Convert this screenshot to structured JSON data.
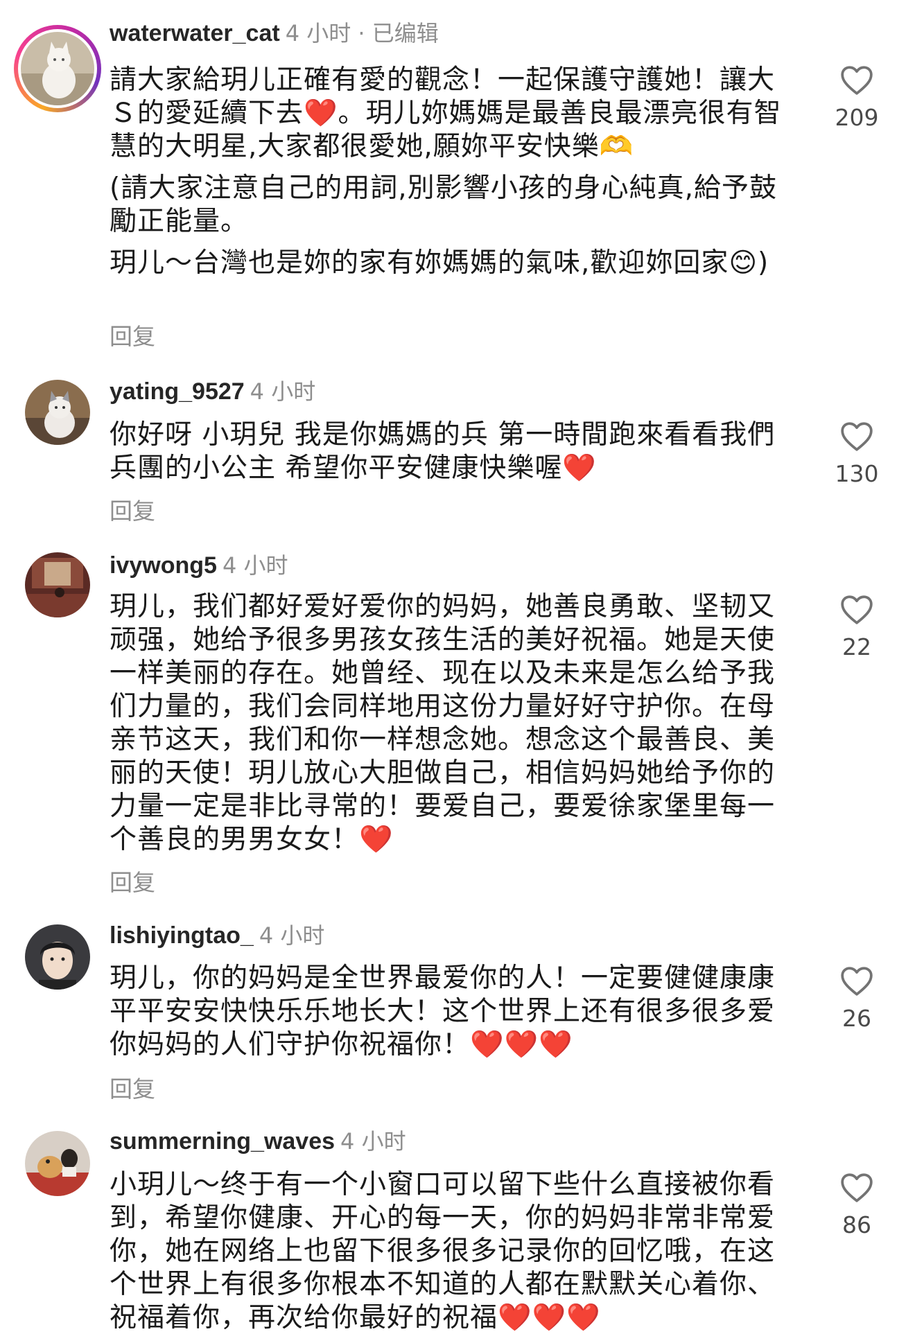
{
  "comments": [
    {
      "username": "waterwater_cat",
      "meta": "4 小时 · 已编辑",
      "paragraphs": [
        "請大家給玥儿正確有愛的觀念！一起保護守護她！讓大Ｓ的愛延續下去❤️。玥儿妳媽媽是最善良最漂亮很有智慧的大明星,大家都很愛她,願妳平安快樂🫶",
        "(請大家注意自己的用詞,別影響小孩的身心純真,給予鼓勵正能量。",
        "玥儿～台灣也是妳的家有妳媽媽的氣味,歡迎妳回家😊)"
      ],
      "reply_label": "回复",
      "like_count": "209"
    },
    {
      "username": "yating_9527",
      "meta": "4 小时",
      "paragraphs": [
        "你好呀 小玥兒 我是你媽媽的兵 第一時間跑來看看我們兵團的小公主 希望你平安健康快樂喔❤️"
      ],
      "reply_label": "回复",
      "like_count": "130"
    },
    {
      "username": "ivywong5",
      "meta": "4 小时",
      "paragraphs": [
        "玥儿，我们都好爱好爱你的妈妈，她善良勇敢、坚韧又顽强，她给予很多男孩女孩生活的美好祝福。她是天使一样美丽的存在。她曾经、现在以及未来是怎么给予我们力量的，我们会同样地用这份力量好好守护你。在母亲节这天，我们和你一样想念她。想念这个最善良、美丽的天使！玥儿放心大胆做自己，相信妈妈她给予你的力量一定是非比寻常的！要爱自己，要爱徐家堡里每一个善良的男男女女！❤️"
      ],
      "reply_label": "回复",
      "like_count": "22"
    },
    {
      "username": "lishiyingtao_",
      "meta": "4 小时",
      "paragraphs": [
        "玥儿，你的妈妈是全世界最爱你的人！一定要健健康康平平安安快快乐乐地长大！这个世界上还有很多很多爱你妈妈的人们守护你祝福你！❤️❤️❤️"
      ],
      "reply_label": "回复",
      "like_count": "26"
    },
    {
      "username": "summerning_waves",
      "meta": "4 小时",
      "paragraphs": [
        "小玥儿～终于有一个小窗口可以留下些什么直接被你看到，希望你健康、开心的每一天，你的妈妈非常非常爱你，她在网络上也留下很多很多记录你的回忆哦，在这个世界上有很多你根本不知道的人都在默默关心着你、祝福着你，再次给你最好的祝福❤️❤️❤️"
      ],
      "reply_label": "",
      "like_count": "86"
    }
  ],
  "colors": {
    "text": "#1a1a1a",
    "meta": "#8e8e8e",
    "heart": "#e4262c"
  },
  "icons": {
    "like": "heart-outline-icon"
  }
}
